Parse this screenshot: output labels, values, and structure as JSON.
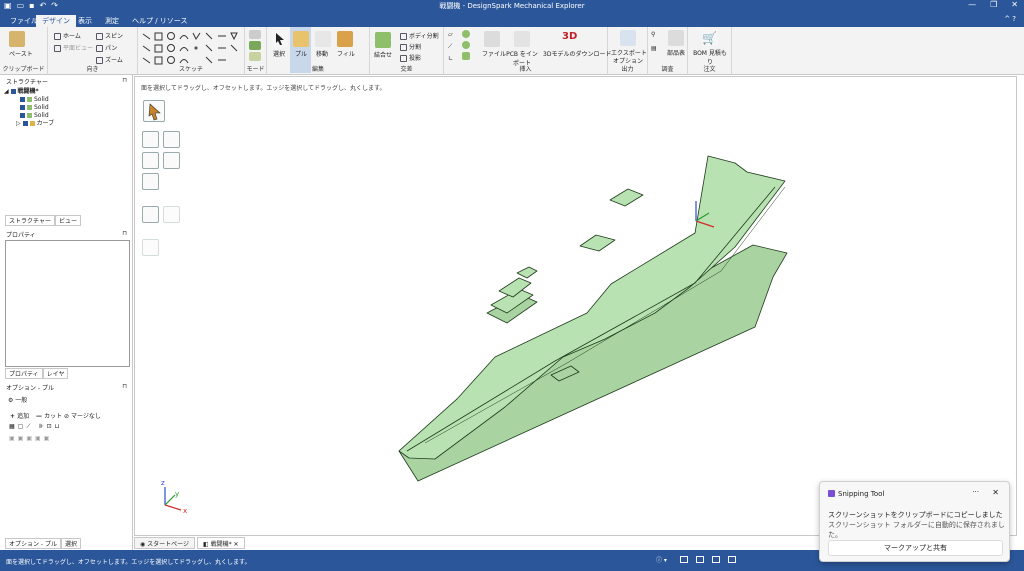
{
  "window": {
    "title": "戦闘機 - DesignSpark Mechanical Explorer"
  },
  "menu": {
    "tabs": [
      "ファイル",
      "デザイン",
      "表示",
      "測定",
      "ヘルプ / リソース"
    ],
    "active": "デザイン"
  },
  "ribbon": {
    "clipboard": {
      "label": "クリップボード",
      "paste": "ペースト"
    },
    "orient": {
      "label": "向き",
      "home": "ホーム",
      "plane_view": "平面ビュー",
      "spin": "スピン",
      "pan": "パン",
      "zoom": "ズーム"
    },
    "sketch": {
      "label": "スケッチ"
    },
    "mode": {
      "label": "モード"
    },
    "edit": {
      "label": "編集",
      "select": "選択",
      "pull": "プル",
      "move": "移動",
      "fill": "フィル"
    },
    "intersect": {
      "label": "交差",
      "combine": "結合せ",
      "boolean_split": "ボディ分割",
      "split": "分割",
      "project": "投影"
    },
    "insert": {
      "label": "挿入",
      "file": "ファイル",
      "pcb": "PCB をインポート",
      "models": "3Dモデルのダウンロード"
    },
    "output": {
      "label": "出力",
      "export": "エクスポート",
      "options": "オプション"
    },
    "survey": {
      "label": "調査",
      "parts": "部品表"
    },
    "order": {
      "label": "注文",
      "bom": "BOM 見積もり"
    }
  },
  "structure": {
    "title": "ストラクチャー",
    "root": "戦闘機",
    "items": [
      "Solid",
      "Solid",
      "Solid",
      "カーブ"
    ],
    "tabs": [
      "ストラクチャー",
      "ビュー"
    ]
  },
  "properties": {
    "title": "プロパティ",
    "tabs": [
      "プロパティ",
      "レイヤ"
    ]
  },
  "options": {
    "title": "オプション - プル",
    "general": "一般",
    "add": "追加",
    "cut": "カット",
    "no_merge": "マージなし",
    "tabs": [
      "オプション - プル",
      "選択"
    ]
  },
  "canvas": {
    "hint": "面を選択してドラッグし、オフセットします。エッジを選択してドラッグし、丸くします。",
    "axes": [
      "x",
      "y",
      "z"
    ]
  },
  "doc_tabs": [
    "スタートページ",
    "戦闘機*"
  ],
  "status": {
    "text": "面を選択してドラッグし、オフセットします。エッジを選択してドラッグし、丸くします。"
  },
  "toast": {
    "app": "Snipping Tool",
    "line1": "スクリーンショットをクリップボードにコピーしました",
    "line2": "スクリーンショット フォルダーに自動的に保存されました。",
    "button": "マークアップと共有"
  },
  "colors": {
    "accent": "#2b579a",
    "model_fill": "#b9e2b3",
    "model_stroke": "#1d3b1a"
  }
}
